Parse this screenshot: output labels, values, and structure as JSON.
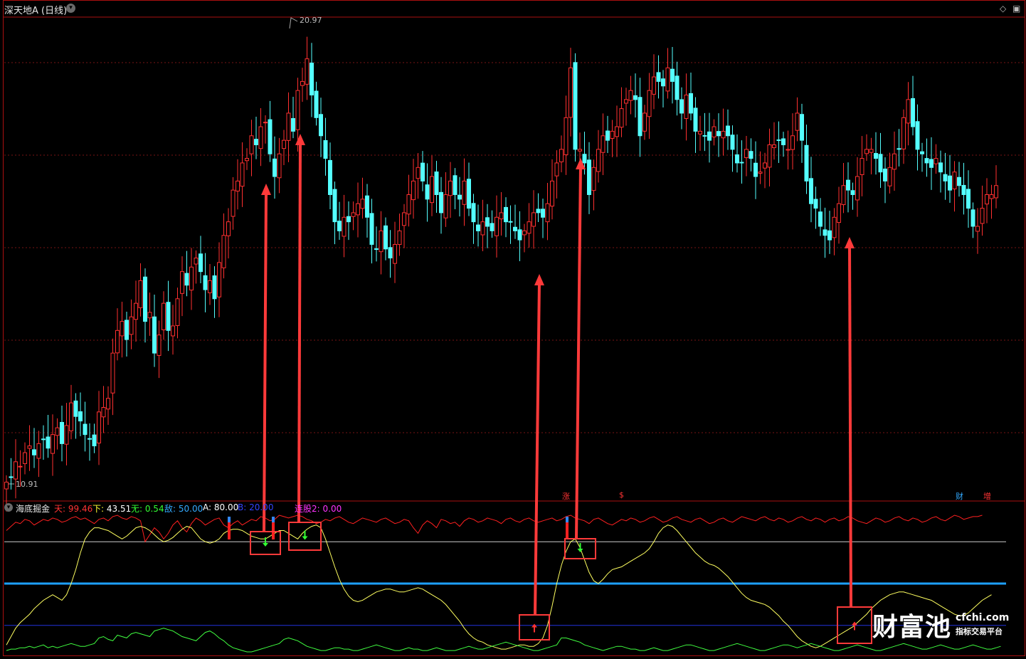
{
  "header": {
    "title": "深天地A",
    "period": "(日线)"
  },
  "upper_controls": [
    "◇",
    "▣"
  ],
  "indicator": {
    "name": "海底掘金",
    "params": [
      {
        "label": "天:",
        "value": "99.46",
        "label_color": "#ff3333",
        "value_color": "#ff3333"
      },
      {
        "label": "下:",
        "value": "43.51",
        "label_color": "#ffff33",
        "value_color": "#ffffff"
      },
      {
        "label": "无:",
        "value": "0.54",
        "label_color": "#33ff33",
        "value_color": "#33ff33"
      },
      {
        "label": "敌:",
        "value": "50.00",
        "label_color": "#33aaff",
        "value_color": "#33aaff"
      },
      {
        "label": "A:",
        "value": "80.00",
        "label_color": "#ffffff",
        "value_color": "#ffffff"
      },
      {
        "label": "B:",
        "value": "20.00",
        "label_color": "#3344ff",
        "value_color": "#3344ff"
      },
      {
        "label": "连股2:",
        "value": "0.00",
        "label_color": "#ff33ff",
        "value_color": "#ff33ff"
      }
    ]
  },
  "event_marks": [
    {
      "label": "涨",
      "color": "#ff3333"
    },
    {
      "label": "$",
      "color": "#ff3333"
    },
    {
      "label": "财",
      "color": "#33aaff"
    },
    {
      "label": "增",
      "color": "#ff3333"
    }
  ],
  "watermark": {
    "brand": "财富池",
    "domain": "cfchi.com",
    "slogan": "指标交易平台"
  },
  "colors": {
    "up": "#ff3030",
    "down": "#54ffff",
    "panel_border": "#aa1010",
    "grid": "#771414",
    "line_top": "#ff2020",
    "line_mid": "#ffff60",
    "line_low": "#40ff40",
    "level_80": "#cccccc",
    "level_50": "#1ea0ff",
    "level_20": "#2233dd",
    "arrow": "#ff3a3a",
    "box": "#ff3a3a"
  },
  "chart_data": [
    {
      "type": "candlestick",
      "title": "深天地A (日线)",
      "price_labels": {
        "high": "20.97",
        "low": "10.91"
      },
      "closes": [
        10.95,
        11.05,
        11.4,
        11.3,
        11.6,
        11.75,
        11.55,
        11.8,
        11.9,
        11.7,
        12.0,
        12.15,
        11.8,
        12.2,
        12.7,
        12.4,
        12.3,
        12.0,
        11.9,
        11.75,
        12.5,
        12.6,
        12.8,
        13.8,
        14.3,
        14.5,
        14.1,
        14.6,
        14.9,
        15.4,
        14.5,
        14.7,
        13.8,
        14.2,
        14.9,
        14.3,
        14.4,
        15.0,
        15.6,
        15.3,
        15.7,
        15.9,
        15.6,
        15.2,
        15.4,
        15.0,
        15.8,
        16.4,
        16.7,
        17.4,
        17.6,
        18.0,
        18.1,
        18.6,
        18.4,
        18.8,
        18.9,
        18.2,
        17.7,
        18.2,
        18.5,
        19.1,
        18.7,
        19.6,
        19.8,
        20.3,
        19.5,
        19.0,
        18.6,
        18.1,
        17.3,
        16.7,
        16.5,
        16.8,
        16.7,
        16.9,
        17.1,
        17.2,
        16.8,
        16.2,
        16.1,
        16.5,
        16.1,
        15.9,
        16.2,
        16.5,
        16.9,
        17.3,
        17.6,
        17.9,
        17.6,
        17.2,
        17.7,
        17.3,
        16.9,
        17.3,
        17.6,
        17.3,
        17.2,
        17.6,
        17.0,
        16.7,
        16.5,
        16.7,
        16.6,
        16.5,
        16.8,
        16.9,
        16.7,
        16.7,
        16.5,
        16.3,
        16.5,
        16.7,
        16.9,
        16.9,
        16.8,
        17.1,
        17.6,
        18.0,
        18.3,
        19.0,
        20.1,
        18.3,
        18.3,
        18.0,
        17.3,
        17.9,
        18.3,
        18.6,
        18.5,
        18.7,
        18.8,
        19.2,
        19.4,
        19.6,
        19.4,
        18.6,
        19.1,
        19.6,
        19.9,
        19.8,
        19.7,
        20.1,
        19.8,
        19.4,
        19.1,
        19.5,
        19.1,
        18.7,
        18.7,
        18.6,
        18.5,
        18.8,
        18.6,
        18.7,
        18.6,
        18.3,
        18.0,
        18.0,
        18.3,
        18.1,
        17.7,
        17.8,
        18.0,
        18.4,
        18.4,
        18.5,
        18.4,
        18.3,
        18.6,
        19.1,
        18.5,
        17.6,
        17.1,
        17.0,
        16.6,
        16.4,
        16.3,
        16.8,
        17.1,
        17.5,
        17.4,
        17.3,
        17.7,
        18.1,
        18.3,
        18.3,
        18.1,
        17.8,
        17.6,
        17.9,
        18.2,
        18.3,
        19.0,
        19.4,
        18.8,
        18.3,
        18.2,
        18.0,
        17.9,
        18.1,
        17.8,
        17.6,
        17.4,
        17.8,
        17.5,
        17.3,
        17.0,
        16.6,
        16.6,
        17.0,
        17.3,
        17.3,
        17.5
      ]
    },
    {
      "type": "line",
      "title": "海底掘金",
      "series": [
        {
          "name": "天",
          "values": [
            88,
            91,
            94,
            93,
            96,
            95,
            92,
            94,
            96,
            95,
            97,
            96,
            94,
            95,
            97,
            98,
            96,
            97,
            95,
            93,
            96,
            97,
            95,
            98,
            99,
            97,
            96,
            98,
            97,
            95,
            80,
            85,
            90,
            87,
            82,
            86,
            92,
            95,
            90,
            87,
            93,
            97,
            95,
            92,
            94,
            96,
            97,
            92,
            90,
            93,
            95,
            92,
            94,
            96,
            95,
            98,
            97,
            95,
            96,
            99,
            98,
            97,
            98,
            99,
            98,
            96,
            95,
            93,
            94,
            96,
            95,
            97,
            98,
            96,
            94,
            93,
            95,
            97,
            96,
            95,
            94,
            96,
            97,
            95,
            93,
            94,
            96,
            95,
            90,
            86,
            92,
            95,
            93,
            90,
            96,
            95,
            93,
            94,
            91,
            95,
            97,
            96,
            94,
            95,
            97,
            96,
            95,
            93,
            96,
            97,
            95,
            94,
            96,
            97,
            95,
            94,
            95,
            96,
            97,
            95,
            96,
            98,
            99,
            97,
            96,
            95,
            93,
            96,
            97,
            95,
            93,
            92,
            94,
            96,
            95,
            97,
            96,
            94,
            95,
            97,
            98,
            96,
            94,
            95,
            97,
            98,
            96,
            95,
            94,
            96,
            97,
            95,
            93,
            94,
            96,
            97,
            95,
            94,
            96,
            98,
            97,
            96,
            95,
            97,
            98,
            96,
            95,
            97,
            96,
            94,
            95,
            97,
            98,
            96,
            95,
            97,
            96,
            94,
            96,
            97,
            95,
            96,
            98,
            97,
            95,
            94,
            93,
            95,
            97,
            96,
            94,
            95,
            97,
            98,
            96,
            95,
            97,
            96,
            94,
            95,
            97,
            98,
            96,
            95,
            97,
            99,
            98,
            96,
            97,
            98,
            98,
            99
          ]
        },
        {
          "name": "下",
          "values": [
            6,
            12,
            18,
            22,
            25,
            28,
            32,
            35,
            38,
            40,
            42,
            40,
            38,
            42,
            50,
            60,
            72,
            82,
            87,
            90,
            90,
            89,
            88,
            86,
            84,
            82,
            84,
            87,
            90,
            91,
            90,
            88,
            85,
            82,
            80,
            81,
            83,
            86,
            89,
            91,
            90,
            86,
            82,
            80,
            79,
            80,
            82,
            86,
            88,
            89,
            89,
            88,
            86,
            84,
            83,
            82,
            82,
            84,
            86,
            88,
            88,
            86,
            84,
            82,
            86,
            89,
            91,
            92,
            90,
            82,
            72,
            62,
            53,
            46,
            41,
            38,
            37,
            38,
            40,
            42,
            44,
            45,
            46,
            46,
            45,
            44,
            44,
            45,
            46,
            47,
            46,
            44,
            42,
            40,
            38,
            35,
            31,
            27,
            23,
            18,
            14,
            11,
            9,
            8,
            6,
            5,
            4,
            3,
            3,
            4,
            5,
            6,
            6,
            5,
            5,
            7,
            11,
            20,
            34,
            50,
            63,
            73,
            80,
            82,
            76,
            67,
            58,
            52,
            50,
            53,
            57,
            60,
            61,
            62,
            64,
            66,
            68,
            70,
            72,
            75,
            80,
            86,
            90,
            92,
            91,
            88,
            84,
            80,
            76,
            72,
            69,
            66,
            64,
            63,
            61,
            58,
            55,
            51,
            47,
            43,
            40,
            38,
            37,
            36,
            35,
            33,
            30,
            27,
            23,
            20,
            16,
            12,
            9,
            7,
            5,
            4,
            5,
            7,
            9,
            11,
            13,
            15,
            17,
            19,
            22,
            25,
            28,
            32,
            35,
            38,
            40,
            42,
            43,
            44,
            44,
            43,
            42,
            41,
            40,
            39,
            38,
            36,
            34,
            32,
            30,
            28,
            27,
            27,
            29,
            32,
            35,
            38,
            40,
            42
          ]
        },
        {
          "name": "无",
          "values": [
            2,
            3,
            3,
            4,
            4,
            5,
            4,
            5,
            6,
            4,
            5,
            4,
            5,
            6,
            7,
            6,
            5,
            5,
            6,
            7,
            11,
            12,
            10,
            9,
            13,
            12,
            11,
            14,
            15,
            14,
            13,
            12,
            16,
            17,
            18,
            17,
            16,
            14,
            12,
            11,
            10,
            9,
            12,
            15,
            16,
            14,
            11,
            9,
            6,
            4,
            3,
            2,
            1,
            1,
            2,
            3,
            4,
            5,
            6,
            7,
            10,
            11,
            10,
            9,
            7,
            5,
            4,
            3,
            2,
            2,
            3,
            4,
            4,
            3,
            3,
            2,
            2,
            3,
            4,
            5,
            6,
            5,
            4,
            3,
            2,
            2,
            3,
            4,
            3,
            3,
            2,
            2,
            3,
            4,
            3,
            2,
            2,
            2,
            3,
            4,
            5,
            4,
            3,
            3,
            4,
            5,
            6,
            7,
            8,
            7,
            6,
            5,
            4,
            3,
            2,
            2,
            3,
            4,
            5,
            6,
            11,
            11,
            10,
            9,
            8,
            6,
            5,
            4,
            3,
            2,
            3,
            4,
            5,
            5,
            4,
            3,
            3,
            2,
            2,
            3,
            4,
            3,
            2,
            2,
            3,
            4,
            5,
            6,
            6,
            5,
            4,
            3,
            2,
            2,
            3,
            4,
            5,
            6,
            7,
            6,
            5,
            4,
            3,
            2,
            2,
            3,
            4,
            5,
            6,
            6,
            5,
            4,
            5,
            6,
            7,
            6,
            5,
            4,
            3,
            2,
            2,
            3,
            4,
            5,
            6,
            5,
            4,
            3,
            2,
            2,
            3,
            4,
            5,
            6,
            7,
            6,
            5,
            4,
            3,
            3,
            4,
            5,
            6,
            5,
            4,
            3,
            3,
            4,
            5,
            6,
            5,
            4,
            3,
            3,
            4,
            5
          ]
        }
      ],
      "levels": [
        {
          "name": "A",
          "value": 80
        },
        {
          "name": "敌",
          "value": 50
        },
        {
          "name": "B",
          "value": 20
        }
      ],
      "ylim": [
        0,
        100
      ]
    }
  ]
}
